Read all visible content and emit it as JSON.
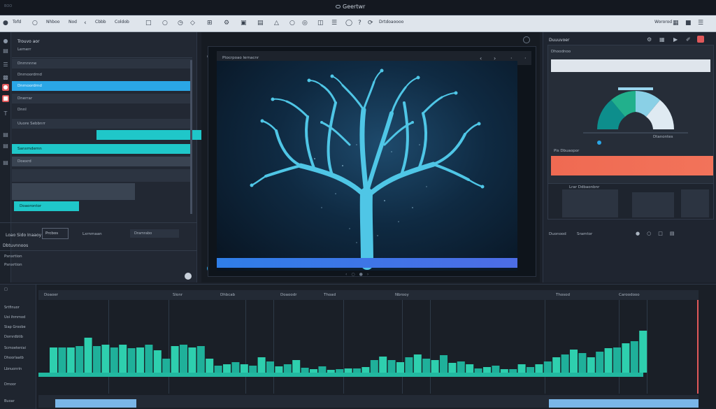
{
  "titlebar": {
    "left": "BOO",
    "title": "Geertwr"
  },
  "toolbar": {
    "items": [
      "Tofd",
      "Nhboo",
      "Nod",
      "Cbbb",
      "Coldob"
    ],
    "right_label": "Drtdoaoooo",
    "far_right": "Wororod"
  },
  "left_panel": {
    "header": "Trouvo aor",
    "sub": "Lemerr",
    "rows": [
      "Dnrnnnne",
      "Dnrnoordrnd",
      "Dnerrar",
      "Dnnl",
      "Uuore Sebbnrr",
      "Sanxmdemn",
      "Doexrd"
    ],
    "bottom_tab": "Doaorontor",
    "section_title": "Loao Sido Inaaoy",
    "section_btn1": "Prcbos",
    "section_btn2": "Lxrnmaan",
    "section_btn3": "Dramrabo",
    "sub_header": "Dbtuvnnoos",
    "sub_item": "Psnxrtion"
  },
  "preview": {
    "header": "Ptocrpoao lernacnr",
    "glyphs": [
      "‹",
      "›",
      "·",
      "‧"
    ]
  },
  "right_panel": {
    "header": "Duuuvoer",
    "menu": "Dhoodnoo",
    "donut_caption": "Dtanontes",
    "bar_label": "Pis Dbuaopor",
    "chart_label": "Lrar Ddbaonbnr",
    "bottom_label": "Duonood",
    "bottom_label2": "Sramtor"
  },
  "timeline": {
    "tracks": [
      "Srtfinuor",
      "Uoi ihmmod",
      "Siap Groobe",
      "Dornrdbtib",
      "Scmoeteniai",
      "Dhoorlaatb",
      "Lbnuonrin",
      "Dmoor",
      "Buoar"
    ],
    "ruler_labels": [
      "Doaoer",
      "Slonr",
      "Dhbcab",
      "Doaoodr",
      "Thoad",
      "Nbrooy",
      "Thosod",
      "Caroodooo"
    ],
    "colors": {
      "bar": "#1fb09a",
      "bar_light": "#2ecfae",
      "baseline": "#2aa6e6"
    }
  },
  "timeline_values": [
    0.36,
    0.36,
    0.36,
    0.38,
    0.5,
    0.38,
    0.4,
    0.36,
    0.4,
    0.35,
    0.36,
    0.4,
    0.32,
    0.2,
    0.38,
    0.4,
    0.36,
    0.38,
    0.2,
    0.1,
    0.12,
    0.15,
    0.12,
    0.1,
    0.22,
    0.16,
    0.09,
    0.12,
    0.18,
    0.07,
    0.05,
    0.09,
    0.04,
    0.05,
    0.06,
    0.06,
    0.08,
    0.18,
    0.23,
    0.18,
    0.15,
    0.22,
    0.26,
    0.2,
    0.18,
    0.25,
    0.14,
    0.16,
    0.12,
    0.06,
    0.08,
    0.1,
    0.05,
    0.05,
    0.12,
    0.08,
    0.12,
    0.16,
    0.22,
    0.26,
    0.33,
    0.28,
    0.22,
    0.3,
    0.35,
    0.36,
    0.42,
    0.45,
    0.6
  ],
  "colors": {
    "accent": "#2aa6e6",
    "teal": "#1fc7c9",
    "alert": "#e0585a",
    "tree": "#4fc6e6"
  }
}
